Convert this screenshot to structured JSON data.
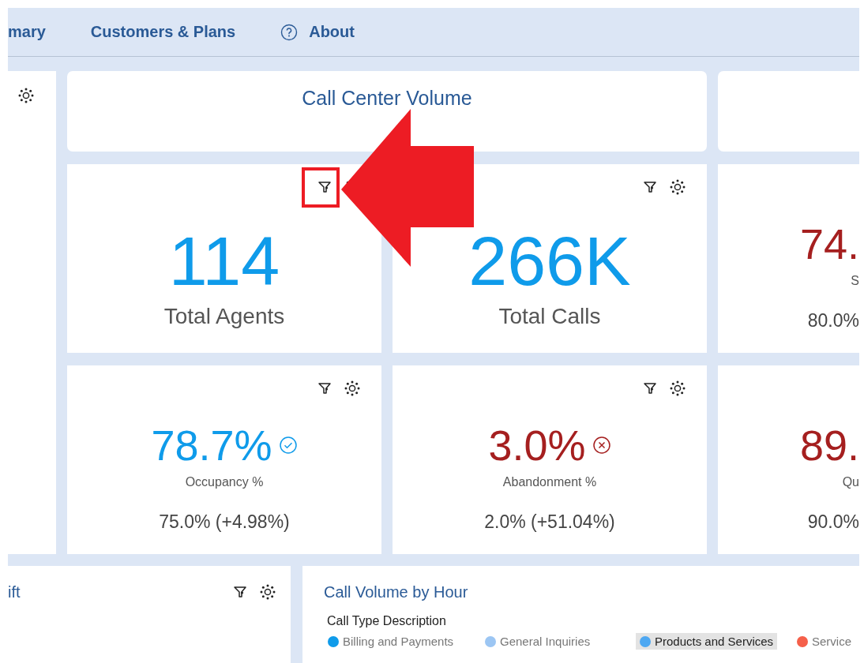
{
  "nav": {
    "items": [
      {
        "label": "mary",
        "kind": "text"
      },
      {
        "label": "Customers & Plans",
        "kind": "text"
      },
      {
        "label": "About",
        "kind": "help"
      }
    ]
  },
  "left_panel": {
    "tools": true
  },
  "title_card": {
    "title": "Call Center Volume"
  },
  "kpis": [
    {
      "kind": "large",
      "value": "114",
      "label": "Total Agents",
      "color": "#0f9bea",
      "tools": true
    },
    {
      "kind": "large",
      "value": "266K",
      "label": "Total Calls",
      "color": "#0f9bea",
      "tools": true
    },
    {
      "kind": "standard",
      "value": "74.",
      "label": "S",
      "comparison": "80.0%",
      "color": "#a51f1f",
      "tools": false
    },
    {
      "kind": "standard",
      "value": "78.7%",
      "label": "Occupancy %",
      "comparison": "75.0% (+4.98%)",
      "color": "#0f9bea",
      "target_met": true,
      "tools": true
    },
    {
      "kind": "standard",
      "value": "3.0%",
      "label": "Abandonment %",
      "comparison": "2.0% (+51.04%)",
      "color": "#a51f1f",
      "target_met": false,
      "tools": true
    },
    {
      "kind": "standard",
      "value": "89.",
      "label": "Qu",
      "comparison": "90.0%",
      "color": "#a51f1f",
      "tools": false
    }
  ],
  "shift_card": {
    "title": "ift",
    "tools": true
  },
  "hour_card": {
    "title": "Call Volume by Hour",
    "legend_title": "Call Type Description",
    "legend": [
      {
        "label": "Billing and Payments",
        "color": "#0f9bea",
        "selected": false
      },
      {
        "label": "General Inquiries",
        "color": "#9cc6f3",
        "selected": false
      },
      {
        "label": "Products and Services",
        "color": "#4ea8f2",
        "selected": true
      },
      {
        "label": "Service",
        "color": "#f5604a",
        "selected": false
      }
    ]
  }
}
